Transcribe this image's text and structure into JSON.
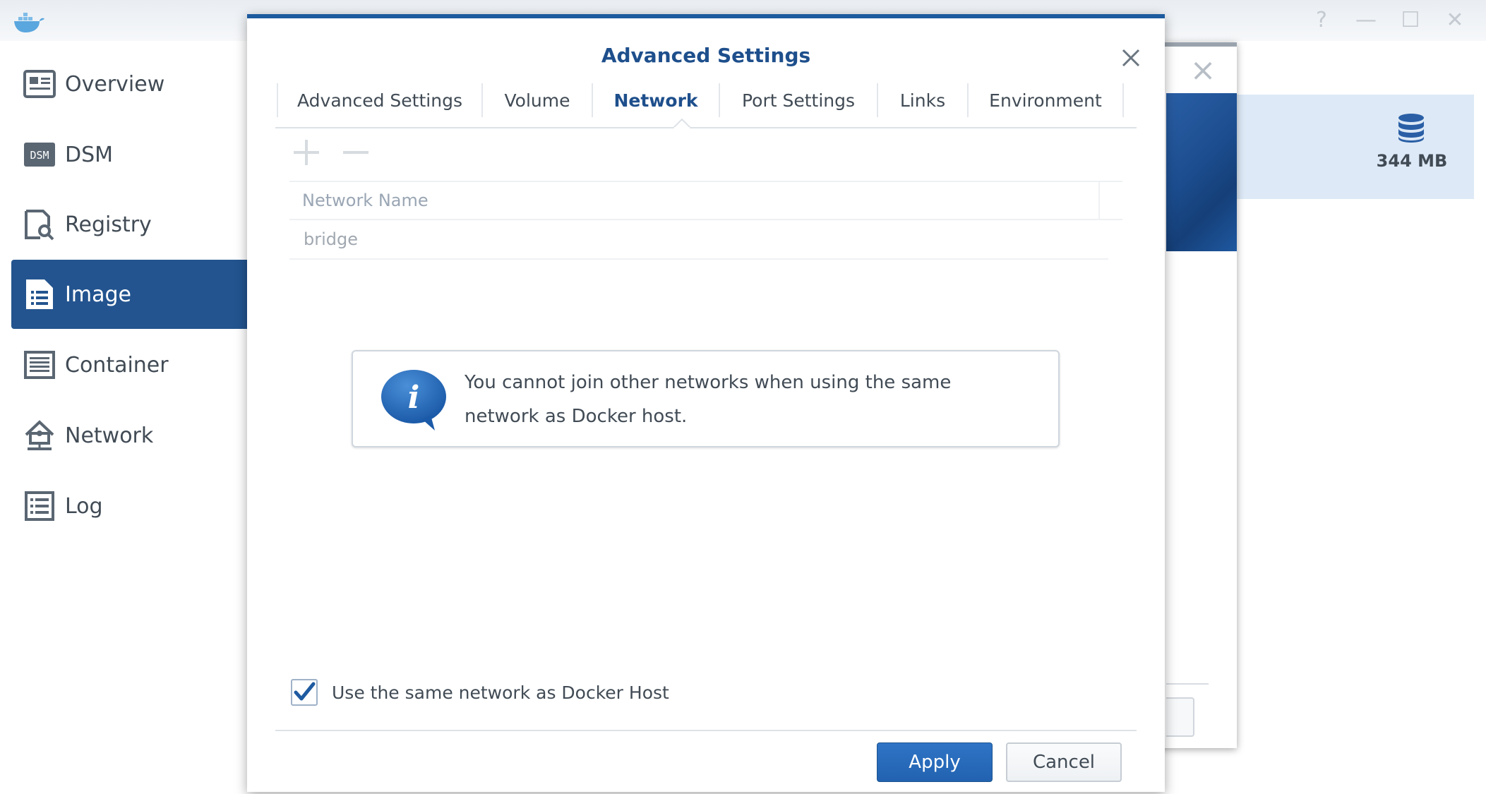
{
  "app": {
    "window_controls": [
      "?",
      "—",
      "☐",
      "✕"
    ]
  },
  "sidebar": {
    "items": [
      {
        "label": "Overview",
        "icon": "overview-icon",
        "active": false
      },
      {
        "label": "DSM",
        "icon": "dsm-icon",
        "icon_text": "DSM",
        "active": false
      },
      {
        "label": "Registry",
        "icon": "registry-icon",
        "active": false
      },
      {
        "label": "Image",
        "icon": "image-icon",
        "active": true
      },
      {
        "label": "Container",
        "icon": "container-icon",
        "active": false
      },
      {
        "label": "Network",
        "icon": "network-icon",
        "active": false
      },
      {
        "label": "Log",
        "icon": "log-icon",
        "active": false
      }
    ]
  },
  "background_dialog": {
    "storage_value": "344 MB"
  },
  "modal": {
    "title": "Advanced Settings",
    "tabs": [
      {
        "label": "Advanced Settings",
        "active": false
      },
      {
        "label": "Volume",
        "active": false
      },
      {
        "label": "Network",
        "active": true
      },
      {
        "label": "Port Settings",
        "active": false
      },
      {
        "label": "Links",
        "active": false
      },
      {
        "label": "Environment",
        "active": false
      }
    ],
    "toolbar": {
      "add": "+",
      "remove": "−"
    },
    "grid": {
      "columns": [
        "Network Name"
      ],
      "rows": [
        [
          "bridge"
        ]
      ]
    },
    "info_message": "You cannot join other networks when using the same network as Docker host.",
    "checkbox": {
      "label": "Use the same network as Docker Host",
      "checked": true
    },
    "buttons": {
      "apply": "Apply",
      "cancel": "Cancel"
    }
  },
  "colors": {
    "accent": "#1e4f8c",
    "sidebar_active": "#23548f",
    "apply_button": "#2668b6"
  }
}
